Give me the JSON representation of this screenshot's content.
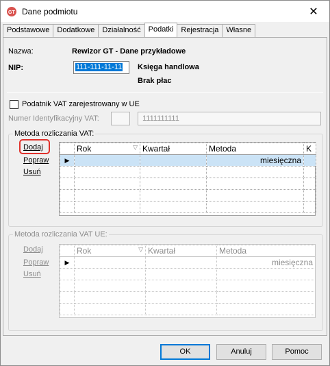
{
  "window": {
    "title": "Dane podmiotu",
    "close_glyph": "✕"
  },
  "tabs": [
    {
      "label": "Podstawowe"
    },
    {
      "label": "Dodatkowe"
    },
    {
      "label": "Działalność"
    },
    {
      "label": "Podatki",
      "active": true
    },
    {
      "label": "Rejestracja"
    },
    {
      "label": "Własne"
    }
  ],
  "header": {
    "name_label": "Nazwa:",
    "name_value": "Rewizor GT - Dane przykładowe",
    "nip_label": "NIP:",
    "nip_value": "111-111-11-11",
    "ledger_type": "Księga handlowa",
    "payroll": "Brak płac"
  },
  "vat_eu": {
    "checkbox_label": "Podatnik VAT zarejestrowany w UE",
    "checked": false,
    "id_label": "Numer Identyfikacyjny VAT:",
    "prefix": "",
    "number": "1111111111"
  },
  "vat_method": {
    "title": "Metoda rozliczania VAT:",
    "links": {
      "add": "Dodaj",
      "edit": "Popraw",
      "delete": "Usuń"
    },
    "columns": [
      "Rok",
      "Kwartał",
      "Metoda",
      "K"
    ],
    "rows": [
      {
        "rok": "",
        "kwartal": "",
        "metoda": "miesięczna",
        "k": "",
        "current": true
      }
    ]
  },
  "vat_method_eu": {
    "title": "Metoda rozliczania VAT UE:",
    "links": {
      "add": "Dodaj",
      "edit": "Popraw",
      "delete": "Usuń"
    },
    "columns": [
      "Rok",
      "Kwartał",
      "Metoda"
    ],
    "rows": [
      {
        "rok": "",
        "kwartal": "",
        "metoda": "miesięczna",
        "current": true
      }
    ]
  },
  "buttons": {
    "ok": "OK",
    "cancel": "Anuluj",
    "help": "Pomoc"
  },
  "colors": {
    "selection": "#cbe3f6",
    "highlight_ring": "#e0312b",
    "accent": "#0078d7"
  }
}
